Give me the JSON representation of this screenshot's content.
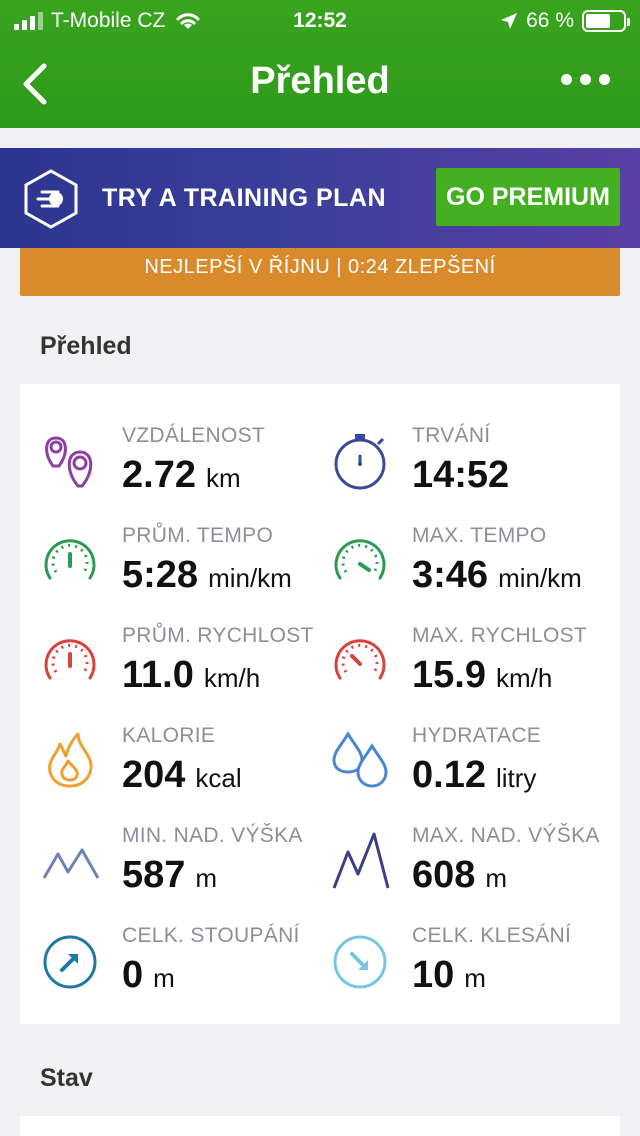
{
  "status_bar": {
    "carrier": "T-Mobile CZ",
    "time": "12:52",
    "battery": "66 %",
    "battery_level": 0.66
  },
  "navbar": {
    "title": "Přehled"
  },
  "banner": {
    "text": "TRY A TRAINING PLAN",
    "button": "GO PREMIUM"
  },
  "achievement_bar": {
    "text": "NEJLEPŠÍ V ŘÍJNU  |  0:24 ZLEPŠENÍ"
  },
  "overview": {
    "title": "Přehled",
    "stats": [
      {
        "label": "VZDÁLENOST",
        "value": "2.72",
        "unit": "km",
        "icon": "location-pins-icon",
        "color": "#8e3fa0"
      },
      {
        "label": "TRVÁNÍ",
        "value": "14:52",
        "unit": "",
        "icon": "stopwatch-icon",
        "color": "#3a4a9a"
      },
      {
        "label": "PRŮM. TEMPO",
        "value": "5:28",
        "unit": "min/km",
        "icon": "pace-gauge-icon",
        "color": "#2b9a52"
      },
      {
        "label": "MAX. TEMPO",
        "value": "3:46",
        "unit": "min/km",
        "icon": "max-pace-gauge-icon",
        "color": "#2b9a52"
      },
      {
        "label": "PRŮM. RYCHLOST",
        "value": "11.0",
        "unit": "km/h",
        "icon": "speed-gauge-icon",
        "color": "#d9413b"
      },
      {
        "label": "MAX. RYCHLOST",
        "value": "15.9",
        "unit": "km/h",
        "icon": "max-speed-gauge-icon",
        "color": "#d9413b"
      },
      {
        "label": "KALORIE",
        "value": "204",
        "unit": "kcal",
        "icon": "flame-icon",
        "color": "#f0a030"
      },
      {
        "label": "HYDRATACE",
        "value": "0.12",
        "unit": "litry",
        "icon": "water-drops-icon",
        "color": "#4a86d0"
      },
      {
        "label": "MIN. NAD. VÝŠKA",
        "value": "587",
        "unit": "m",
        "icon": "min-elevation-icon",
        "color": "#6f82b8"
      },
      {
        "label": "MAX. NAD. VÝŠKA",
        "value": "608",
        "unit": "m",
        "icon": "max-elevation-icon",
        "color": "#3a3f86"
      },
      {
        "label": "CELK. STOUPÁNÍ",
        "value": "0",
        "unit": "m",
        "icon": "ascent-arrow-icon",
        "color": "#1f78a6"
      },
      {
        "label": "CELK. KLESÁNÍ",
        "value": "10",
        "unit": "m",
        "icon": "descent-arrow-icon",
        "color": "#76c6df"
      }
    ]
  },
  "state": {
    "title": "Stav"
  }
}
